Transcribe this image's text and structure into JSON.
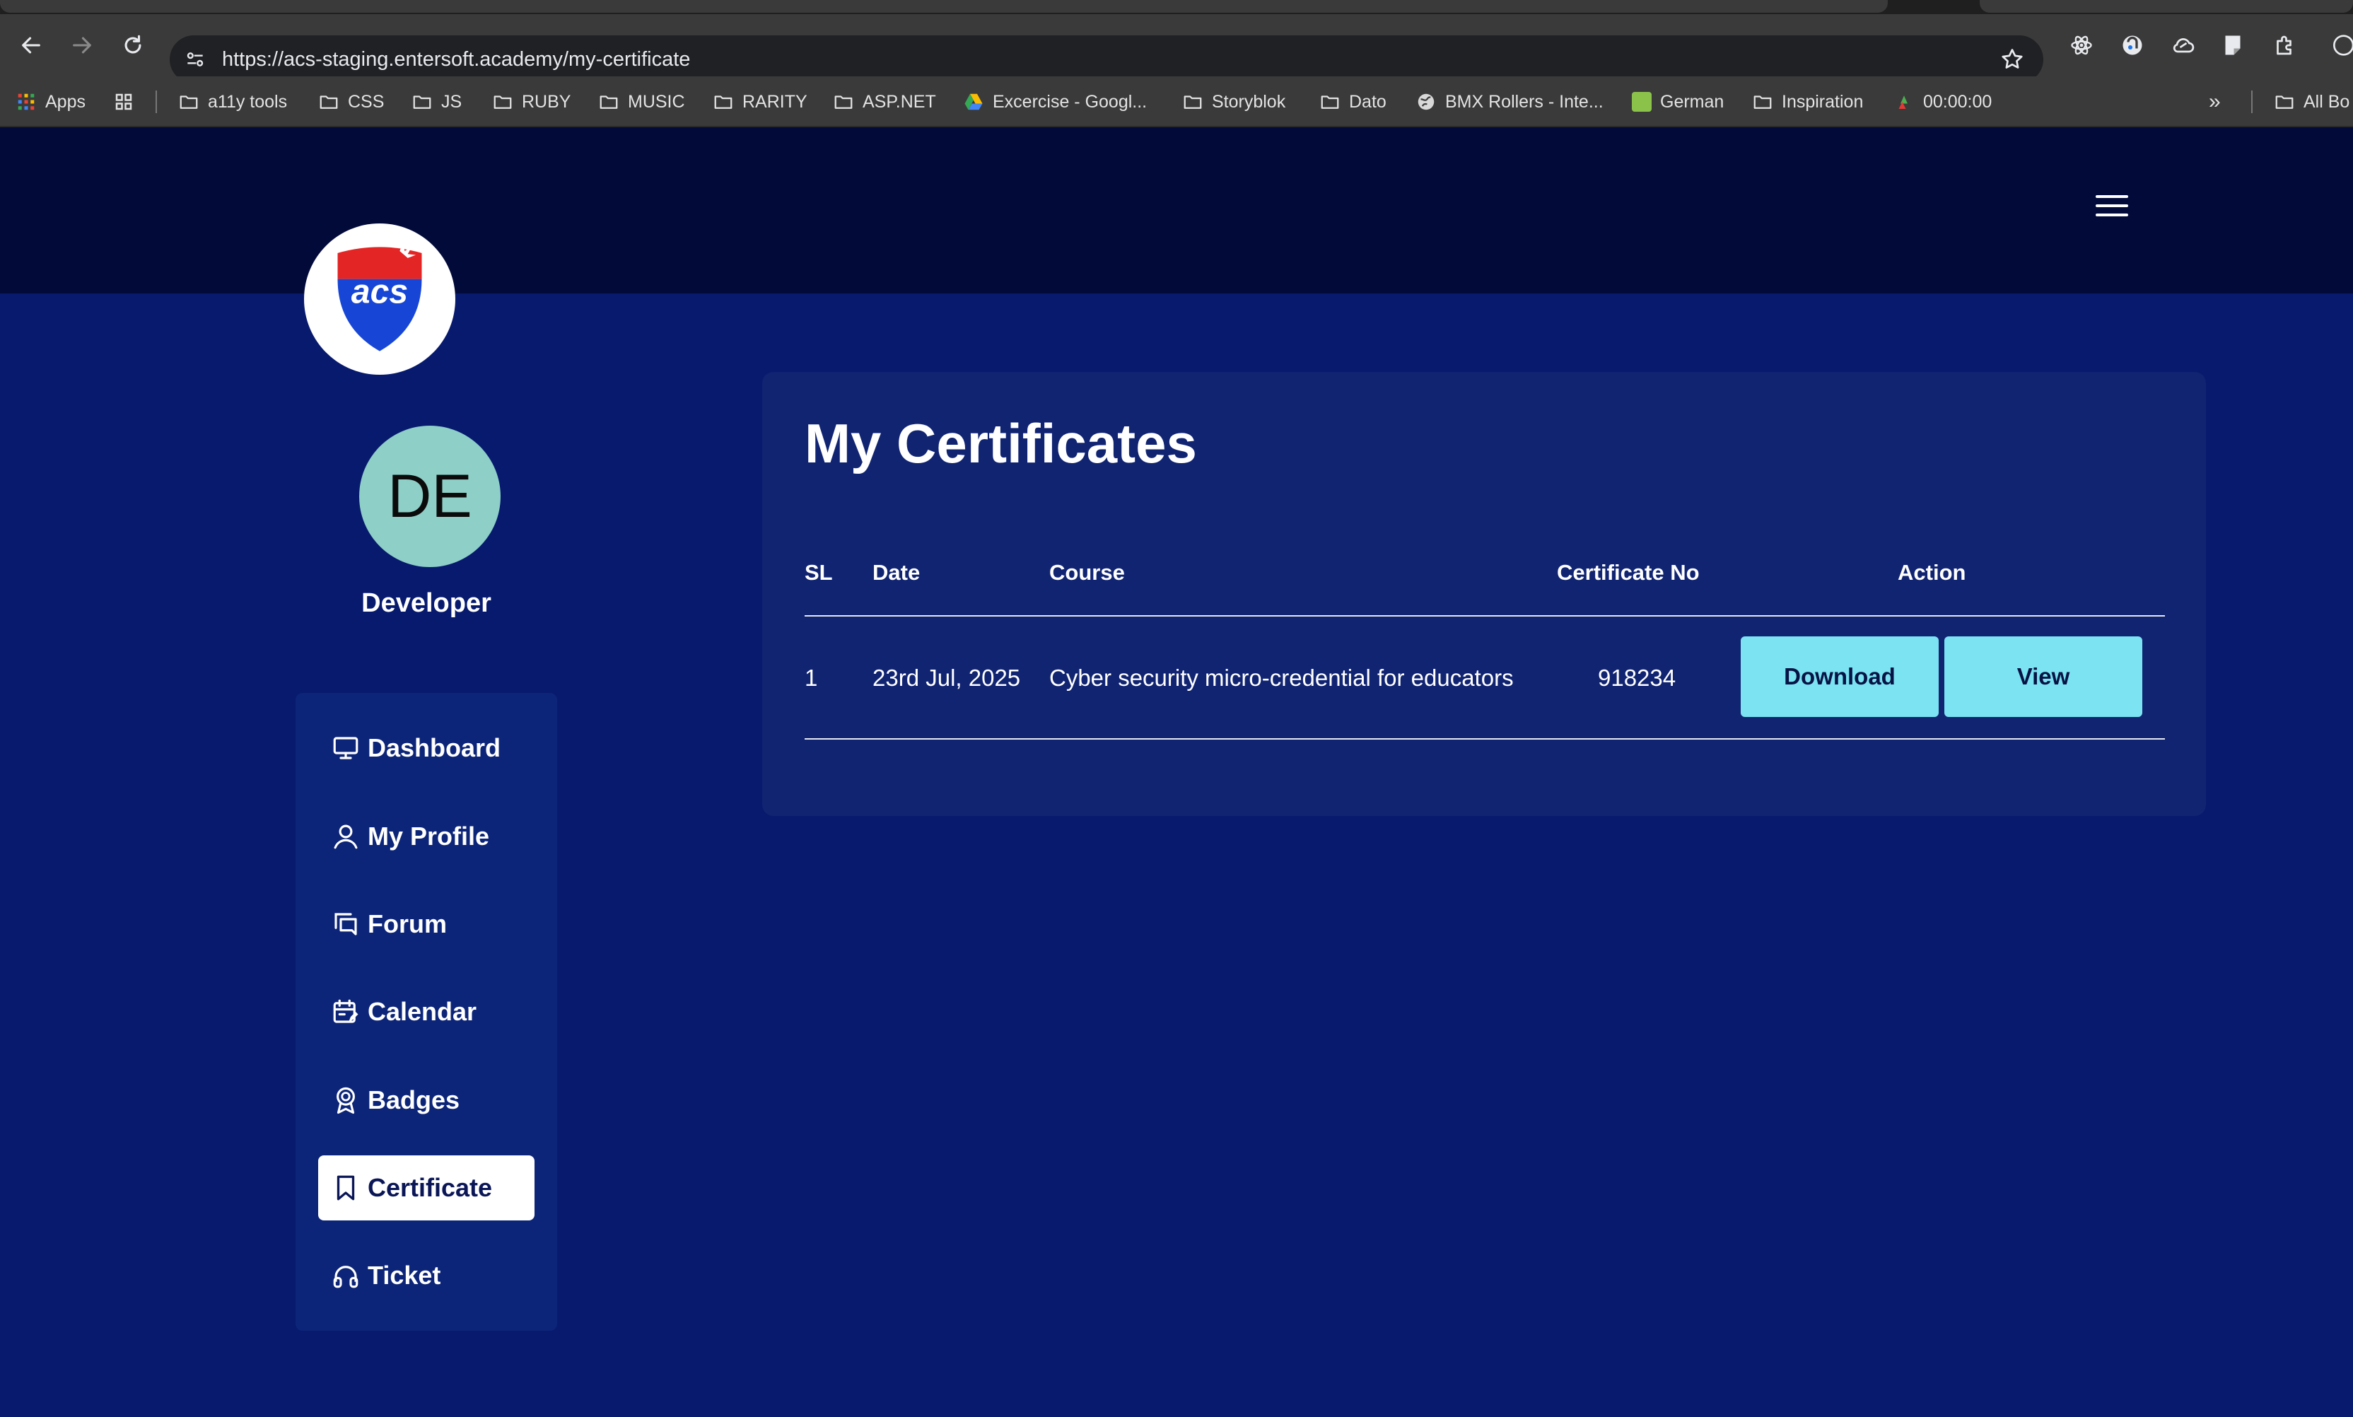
{
  "browser": {
    "url": "https://acs-staging.entersoft.academy/my-certificate",
    "icons": [
      "back-icon",
      "forward-icon",
      "reload-icon",
      "site-info-icon",
      "bookmark-star-icon",
      "react-devtools-icon",
      "extension-icon",
      "cloud-extension-icon",
      "notes-extension-icon",
      "puzzle-extensions-icon"
    ],
    "bookmarks": [
      {
        "label": "Apps",
        "icon": "apps-grid-icon"
      },
      {
        "label": "",
        "icon": "tab-groups-icon"
      },
      {
        "label": "a11y tools",
        "icon": "folder-icon"
      },
      {
        "label": "CSS",
        "icon": "folder-icon"
      },
      {
        "label": "JS",
        "icon": "folder-icon"
      },
      {
        "label": "RUBY",
        "icon": "folder-icon"
      },
      {
        "label": "MUSIC",
        "icon": "folder-icon"
      },
      {
        "label": "RARITY",
        "icon": "folder-icon"
      },
      {
        "label": "ASP.NET",
        "icon": "folder-icon"
      },
      {
        "label": "Excercise - Googl...",
        "icon": "google-drive-icon"
      },
      {
        "label": "Storyblok",
        "icon": "folder-icon"
      },
      {
        "label": "Dato",
        "icon": "folder-icon"
      },
      {
        "label": "BMX Rollers - Inte...",
        "icon": "globe-icon"
      },
      {
        "label": "German",
        "icon": "german-favicon"
      },
      {
        "label": "Inspiration",
        "icon": "folder-icon"
      },
      {
        "label": "00:00:00",
        "icon": "timer-favicon"
      }
    ],
    "overflow_label": "»",
    "all_bookmarks_label": "All Bo"
  },
  "colors": {
    "header_bg": "#020a3a",
    "page_bg": "#071a6e",
    "card_bg": "#112472",
    "button_bg": "#7be3f2",
    "avatar_bg": "#8ecfc7"
  },
  "site": {
    "logo_text": "acs",
    "menu_icon": "hamburger-menu-icon"
  },
  "user": {
    "initials": "DE",
    "name": "Developer"
  },
  "nav": {
    "items": [
      {
        "label": "Dashboard",
        "icon": "monitor-icon",
        "active": false
      },
      {
        "label": "My Profile",
        "icon": "user-icon",
        "active": false
      },
      {
        "label": "Forum",
        "icon": "chat-icon",
        "active": false
      },
      {
        "label": "Calendar",
        "icon": "calendar-icon",
        "active": false
      },
      {
        "label": "Badges",
        "icon": "badge-icon",
        "active": false
      },
      {
        "label": "Certificate",
        "icon": "bookmark-icon",
        "active": true
      },
      {
        "label": "Ticket",
        "icon": "headphones-icon",
        "active": false
      }
    ]
  },
  "certificates": {
    "title": "My Certificates",
    "columns": [
      "SL",
      "Date",
      "Course",
      "Certificate No",
      "Action"
    ],
    "rows": [
      {
        "sl": "1",
        "date": "23rd Jul, 2025",
        "course": "Cyber security micro-credential for educators",
        "certificate_no": "918234",
        "download_label": "Download",
        "view_label": "View"
      }
    ]
  }
}
